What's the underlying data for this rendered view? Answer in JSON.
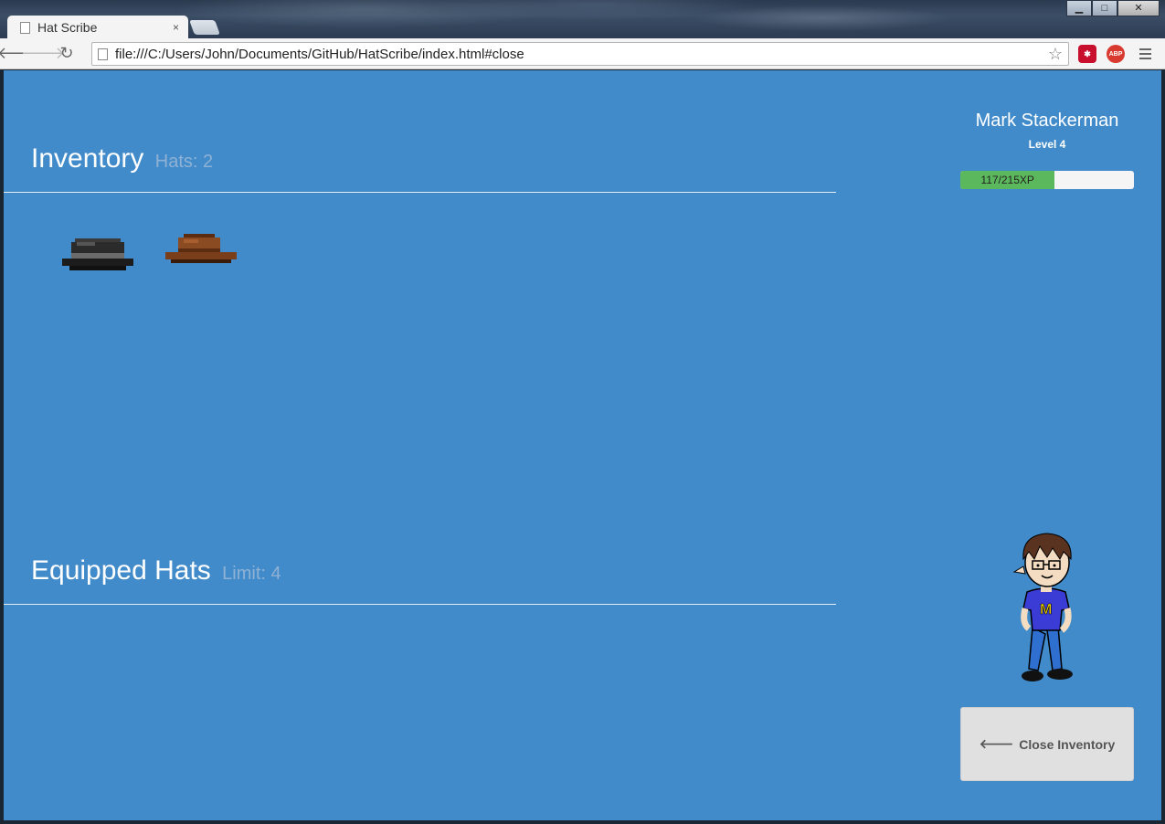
{
  "browser": {
    "tab_title": "Hat Scribe",
    "tab_close": "×",
    "url": "file:///C:/Users/John/Documents/GitHub/HatScribe/index.html#close",
    "ext_lastpass": "✱",
    "ext_abp": "ABP",
    "win_min": "▁",
    "win_max": "□",
    "win_close": "✕"
  },
  "inventory": {
    "title": "Inventory",
    "count_label": "Hats: 2",
    "hats": [
      {
        "name": "black fedora",
        "color": "#2b2b2b"
      },
      {
        "name": "brown fedora",
        "color": "#8a4a22"
      }
    ]
  },
  "equipped": {
    "title": "Equipped Hats",
    "limit_label": "Limit: 4"
  },
  "player": {
    "name": "Mark Stackerman",
    "level": "Level 4",
    "xp_text": "117/215XP",
    "xp_fraction": 0.544
  },
  "actions": {
    "close_inventory": "Close Inventory"
  },
  "colors": {
    "background": "#428bca",
    "xp_fill": "#5cb85c",
    "muted_label": "#8fb1d4"
  }
}
